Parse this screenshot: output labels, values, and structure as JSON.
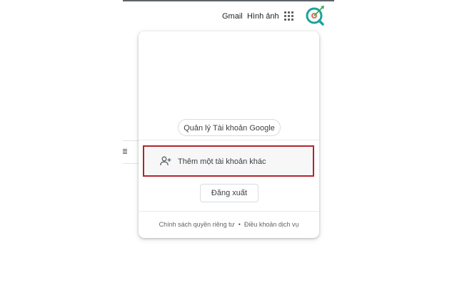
{
  "header": {
    "gmail_label": "Gmail",
    "images_label": "Hình ảnh",
    "apps_icon": "apps-grid-icon",
    "avatar_icon": "magnifier-target-avatar",
    "accent_teal": "#1aa39a",
    "accent_green": "#34a853"
  },
  "account_menu": {
    "manage_account_label": "Quản lý Tài khoản Google",
    "add_account_label": "Thêm một tài khoản khác",
    "add_account_icon": "person-add-icon",
    "highlight_color": "#b3252d",
    "sign_out_label": "Đăng xuất",
    "footer": {
      "privacy_label": "Chính sách quyền riêng tư",
      "separator": "•",
      "terms_label": "Điều khoản dịch vụ"
    }
  }
}
